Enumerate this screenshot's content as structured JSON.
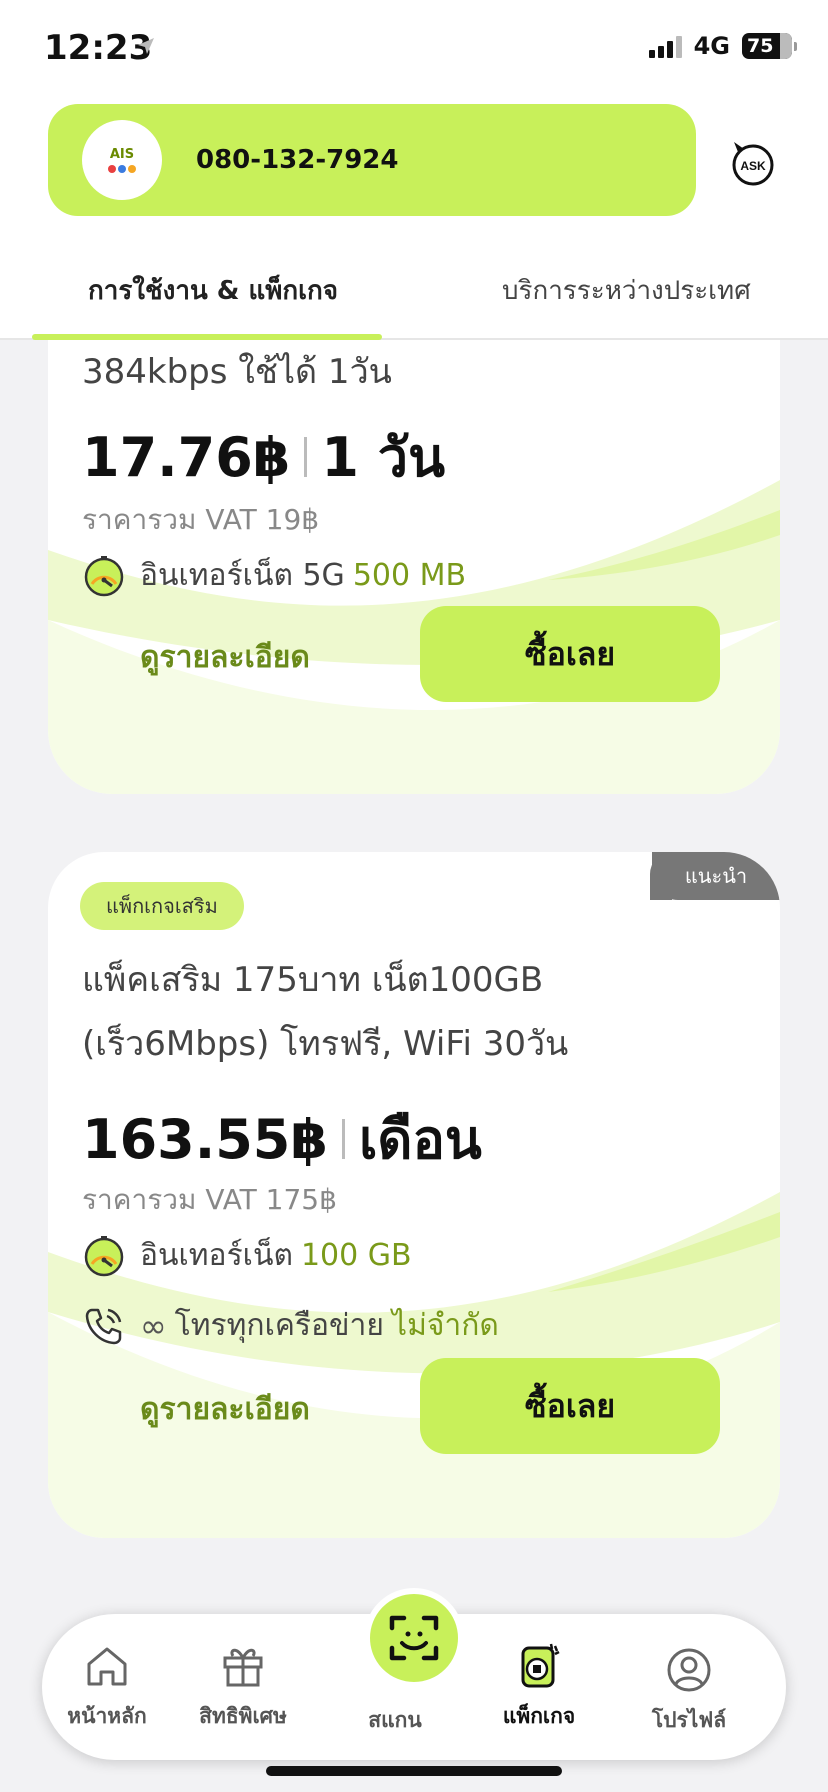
{
  "status_bar": {
    "time": "12:23",
    "network": "4G",
    "battery": "75"
  },
  "header": {
    "phone_number": "080-132-7924",
    "logo_text": "AIS",
    "ask_label": "ASK"
  },
  "tabs": [
    {
      "label": "การใช้งาน & แพ็กเกจ",
      "active": true
    },
    {
      "label": "บริการระหว่างประเทศ",
      "active": false
    }
  ],
  "packages": [
    {
      "title": "384kbps ใช้ได้ 1วัน",
      "price": "17.76฿",
      "period": "1 วัน",
      "vat": "ราคารวม VAT 19฿",
      "features": [
        {
          "icon": "speed-gauge-icon",
          "label": "อินเทอร์เน็ต 5G",
          "value": "500 MB"
        }
      ],
      "detail_label": "ดูรายละเอียด",
      "buy_label": "ซื้อเลย"
    },
    {
      "badge": "แพ็กเกจเสริม",
      "ribbon": "แนะนำ",
      "title_line1": "แพ็คเสริม 175บาท เน็ต100GB",
      "title_line2": "(เร็ว6Mbps) โทรฟรี, WiFi 30วัน",
      "price": "163.55฿",
      "period": "เดือน",
      "vat": "ราคารวม VAT 175฿",
      "features": [
        {
          "icon": "speed-gauge-icon",
          "label": "อินเทอร์เน็ต",
          "value": "100 GB"
        },
        {
          "icon": "phone-call-icon",
          "prefix": "∞",
          "label": "โทรทุกเครือข่าย",
          "value": "ไม่จำกัด"
        }
      ],
      "detail_label": "ดูรายละเอียด",
      "buy_label": "ซื้อเลย"
    }
  ],
  "bottom_nav": [
    {
      "label": "หน้าหลัก",
      "icon": "home-icon"
    },
    {
      "label": "สิทธิพิเศษ",
      "icon": "gift-icon"
    },
    {
      "label": "สแกน",
      "icon": "scan-icon"
    },
    {
      "label": "แพ็กเกจ",
      "icon": "sim-package-icon",
      "active": true
    },
    {
      "label": "โปรไฟล์",
      "icon": "profile-icon"
    }
  ],
  "colors": {
    "accent": "#c8f05a",
    "accent_text": "#6a8a1a",
    "background": "#f2f2f4"
  }
}
